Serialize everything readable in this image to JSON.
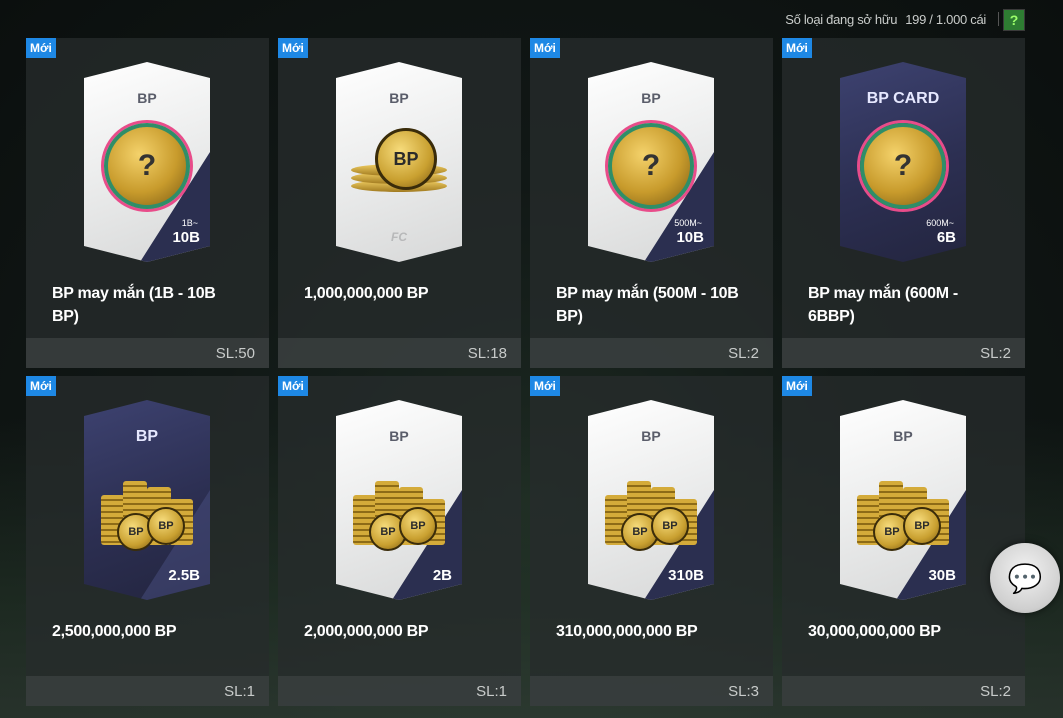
{
  "header": {
    "owned_label": "Số loại đang sở hữu",
    "owned_count": "199 / 1.000 cái",
    "help": "?"
  },
  "items": [
    {
      "badge": "Mới",
      "pack_title": "BP",
      "range": "1B~",
      "amount": "10B",
      "name": "BP may mắn (1B - 10B BP)",
      "qty": "SL:50",
      "art": "mystery"
    },
    {
      "badge": "Mới",
      "pack_title": "BP",
      "range": "",
      "amount": "",
      "name": "1,000,000,000 BP",
      "qty": "SL:18",
      "art": "coins"
    },
    {
      "badge": "Mới",
      "pack_title": "BP",
      "range": "500M~",
      "amount": "10B",
      "name": "BP may mắn (500M - 10B BP)",
      "qty": "SL:2",
      "art": "mystery"
    },
    {
      "badge": "Mới",
      "pack_title": "BP CARD",
      "range": "600M~",
      "amount": "6B",
      "name": "BP may mắn (600M - 6BBP)",
      "qty": "SL:2",
      "art": "mystery-dark"
    },
    {
      "badge": "Mới",
      "pack_title": "BP",
      "range": "",
      "amount": "2.5B",
      "name": "2,500,000,000 BP",
      "qty": "SL:1",
      "art": "stack-dark"
    },
    {
      "badge": "Mới",
      "pack_title": "BP",
      "range": "",
      "amount": "2B",
      "name": "2,000,000,000 BP",
      "qty": "SL:1",
      "art": "stack"
    },
    {
      "badge": "Mới",
      "pack_title": "BP",
      "range": "",
      "amount": "310B",
      "name": "310,000,000,000 BP",
      "qty": "SL:3",
      "art": "stack"
    },
    {
      "badge": "Mới",
      "pack_title": "BP",
      "range": "",
      "amount": "30B",
      "name": "30,000,000,000 BP",
      "qty": "SL:2",
      "art": "stack"
    }
  ],
  "art_text": {
    "mystery": "?",
    "coin_label": "BP",
    "ea_logo": "FC"
  }
}
